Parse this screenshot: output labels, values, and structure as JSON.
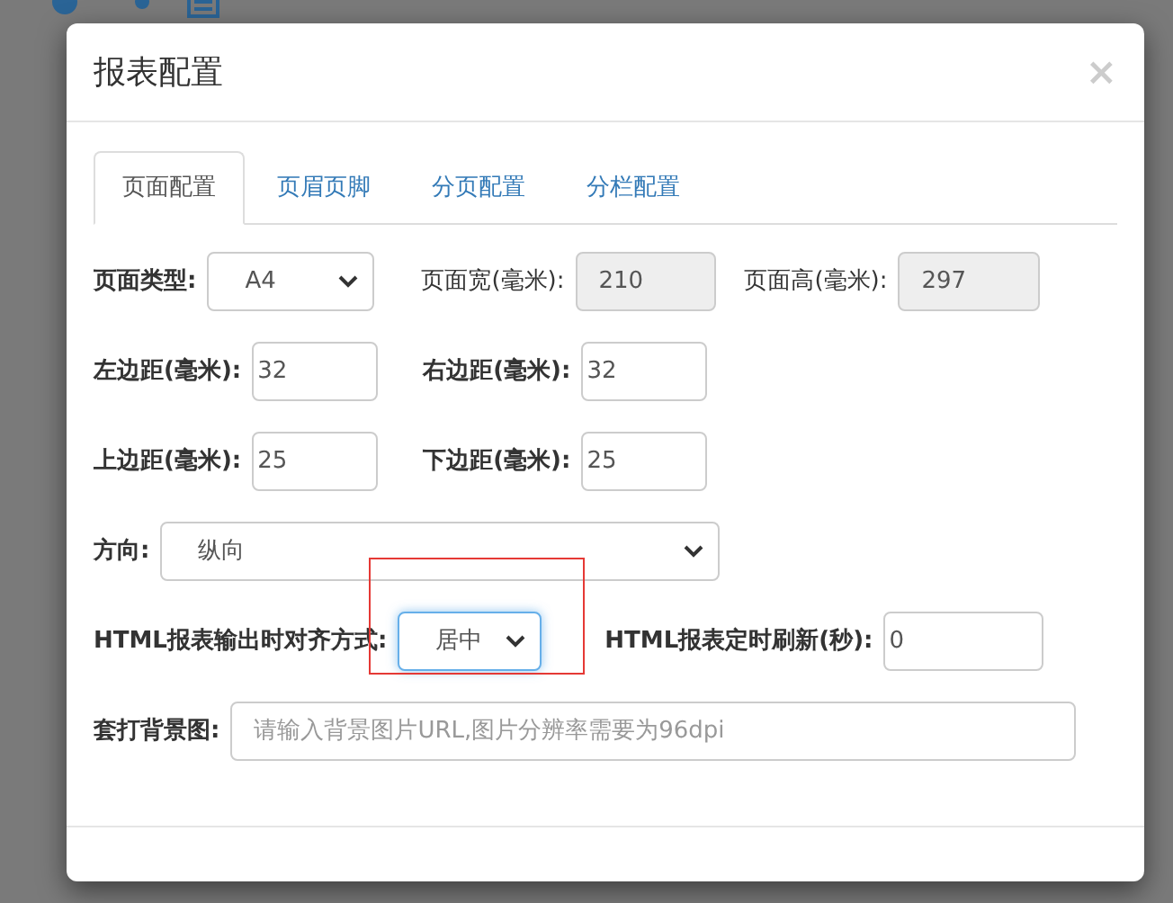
{
  "dialog": {
    "title": "报表配置",
    "close": "×"
  },
  "tabs": [
    {
      "label": "页面配置",
      "selected": true
    },
    {
      "label": "页眉页脚",
      "selected": false
    },
    {
      "label": "分页配置",
      "selected": false
    },
    {
      "label": "分栏配置",
      "selected": false
    }
  ],
  "form_rows": [
    [
      {
        "label": "页面类型:",
        "bold": true,
        "kind": "select",
        "value": "A4"
      },
      {
        "label": "页面宽(毫米):",
        "bold": false,
        "kind": "readonly",
        "value": "210"
      },
      {
        "label": "页面高(毫米):",
        "bold": false,
        "kind": "readonly",
        "value": "297"
      }
    ],
    [
      {
        "label": "左边距(毫米):",
        "bold": true,
        "kind": "input",
        "value": "32"
      },
      {
        "label": "右边距(毫米):",
        "bold": true,
        "kind": "input",
        "value": "32"
      }
    ],
    [
      {
        "label": "上边距(毫米):",
        "bold": true,
        "kind": "input",
        "value": "25"
      },
      {
        "label": "下边距(毫米):",
        "bold": true,
        "kind": "input",
        "value": "25"
      }
    ],
    [
      {
        "label": "方向:",
        "bold": true,
        "kind": "select",
        "value": "纵向"
      }
    ],
    [
      {
        "label": "HTML报表输出时对齐方式:",
        "bold": true,
        "kind": "select",
        "value": "居中",
        "focused": true,
        "highlighted": true
      },
      {
        "label": "HTML报表定时刷新(秒):",
        "bold": true,
        "kind": "input",
        "value": "0"
      }
    ],
    [
      {
        "label": "套打背景图:",
        "bold": true,
        "kind": "input",
        "placeholder": "请输入背景图片URL,图片分辨率需要为96dpi"
      }
    ]
  ]
}
